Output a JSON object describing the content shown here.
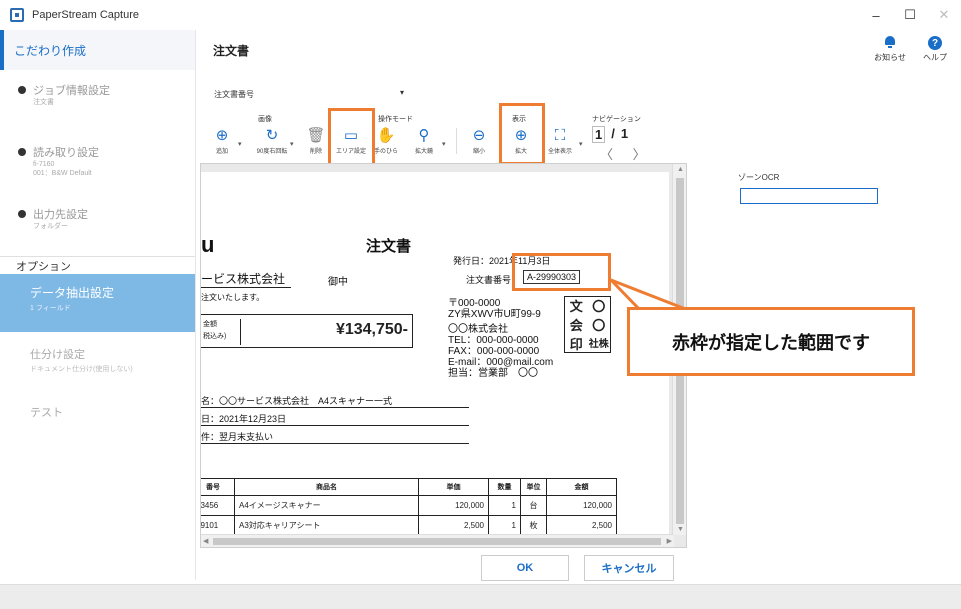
{
  "window": {
    "title": "PaperStream Capture",
    "minimize": "–",
    "maximize": "☐",
    "close": "✕"
  },
  "sidebar": {
    "top": "こだわり作成",
    "steps": [
      {
        "label": "ジョブ情報設定",
        "sub": [
          "注文書"
        ]
      },
      {
        "label": "読み取り設定",
        "sub": [
          "fi-7160",
          "001：B&W Default"
        ]
      },
      {
        "label": "出力先設定",
        "sub": [
          "フォルダー"
        ]
      }
    ],
    "section": "オプション",
    "selected": {
      "label": "データ抽出設定",
      "sub": "1 フィールド"
    },
    "items": [
      {
        "label": "仕分け設定",
        "sub": "ドキュメント仕分け(使用しない)"
      },
      {
        "label": "テスト",
        "sub": ""
      }
    ]
  },
  "header": {
    "title": "注文書",
    "notice": "お知らせ",
    "help": "ヘルプ"
  },
  "field_select": {
    "value": "注文書番号"
  },
  "toolbar": {
    "groups": {
      "image": "画像",
      "mode": "操作モード",
      "display": "表示",
      "nav": "ナビゲーション"
    },
    "tools": {
      "add": "追加",
      "rotate": "90度右回転",
      "delete": "削除",
      "area": "エリア設定",
      "hand": "手のひら",
      "magnify": "拡大鏡",
      "zoom_out": "縮小",
      "zoom_in": "拡大",
      "fit": "全体表示"
    },
    "page_current": "1",
    "page_sep": "/",
    "page_total": "1",
    "nav_arrows": "〈 〉"
  },
  "document": {
    "logo": "u",
    "title": "注文書",
    "client": "ービス株式会社",
    "honorific": "御中",
    "intro": "注文いたします。",
    "amount_label1": "金額",
    "amount_label2": "税込み)",
    "amount": "¥134,750-",
    "issue_date": "発行日：2021年11月3日",
    "order_no_label": "注文書番号：",
    "order_no": "A-29990303",
    "address": [
      "〒000-0000",
      "ZY県XWV市U町99-9",
      "〇〇株式会社",
      "TEL：000-000-0000",
      "FAX：000-000-0000",
      "E-mail：000@mail.com",
      "担当：営業部　〇〇"
    ],
    "stamp": [
      "文",
      "〇",
      "会",
      "〇",
      "印",
      "社株"
    ],
    "subject": "名：〇〇サービス株式会社　A4スキャナー一式",
    "delivery": "日：2021年12月23日",
    "payment": "件：翌月末支払い",
    "table": {
      "headers": [
        "番号",
        "商品名",
        "単価",
        "数量",
        "単位",
        "金額"
      ],
      "rows": [
        [
          "23456",
          "A4イメージスキャナー",
          "120,000",
          "1",
          "台",
          "120,000"
        ],
        [
          "89101",
          "A3対応キャリアシート",
          "2,500",
          "1",
          "枚",
          "2,500"
        ]
      ]
    }
  },
  "callout": {
    "text": "赤枠が指定した範囲です"
  },
  "zone": {
    "label": "ゾーンOCR",
    "value": ""
  },
  "buttons": {
    "ok": "OK",
    "cancel": "キャンセル"
  },
  "colors": {
    "accent": "#1a6ec8",
    "highlight": "#ee7d31",
    "selected": "#7eb9e6"
  }
}
